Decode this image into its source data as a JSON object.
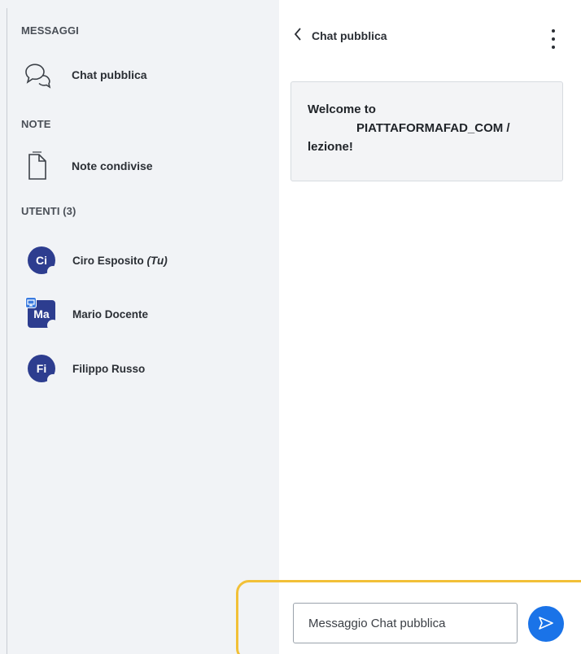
{
  "sidebar": {
    "messages_title": "MESSAGGI",
    "public_chat_label": "Chat pubblica",
    "notes_title": "NOTE",
    "shared_notes_label": "Note condivise",
    "users_title": "UTENTI (3)",
    "users": [
      {
        "initials": "Ci",
        "name": "Ciro Esposito",
        "suffix": "(Tu)"
      },
      {
        "initials": "Ma",
        "name": "Mario Docente",
        "suffix": ""
      },
      {
        "initials": "Fi",
        "name": "Filippo Russo",
        "suffix": ""
      }
    ]
  },
  "chat": {
    "title": "Chat pubblica",
    "welcome_line1": "Welcome to",
    "welcome_line2": "PIATTAFORMAFAD_COM /",
    "welcome_line3": "lezione!",
    "input_placeholder": "Messaggio Chat pubblica"
  },
  "colors": {
    "accent": "#1a73e8",
    "avatar": "#2d3d8f",
    "highlight": "#f2c037"
  }
}
